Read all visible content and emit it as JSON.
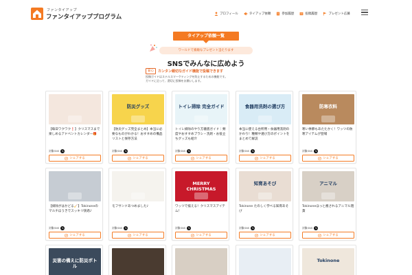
{
  "header": {
    "brand_sub": "ファンタイアップ",
    "brand_main": "ファンタイアッププログラム",
    "nav": [
      {
        "label": "プロフィール",
        "icon": "person-icon"
      },
      {
        "label": "タイアップ依頼",
        "icon": "megaphone-icon"
      },
      {
        "label": "参加履歴",
        "icon": "document-icon"
      },
      {
        "label": "投稿履歴",
        "icon": "list-icon"
      },
      {
        "label": "プレゼント応募",
        "icon": "flag-icon"
      }
    ]
  },
  "section": {
    "badge": "タイアップ依頼一覧",
    "promo": "ワールドで素敵なプレゼント当たります",
    "headline": "SNSでみんなに広めよう",
    "safe_badge": "安心",
    "safe_text": "カンタン親切なガイド機能で投稿できます",
    "desc_1": "投稿ガイドはステルスマーケティングを防止するための機能です。",
    "desc_2": "ガイドに沿って、適切に投稿をお願いします。"
  },
  "cards": [
    {
      "title": "【毎日ワクワク❗️】クリスマスまで楽しめるアドベントカレンダー🎁",
      "target": "対象SNS",
      "share": "シェアする",
      "thumb": "advent",
      "color": "#f4e7de"
    },
    {
      "title": "【防災グッズ完全まとめ】本当に必要なものがわかる！おすすめの備品リストと保存方法",
      "target": "対象SNS",
      "share": "シェアする",
      "thumb": "bousai",
      "color": "#f7d44c",
      "thumb_text": "防災グッズ"
    },
    {
      "title": "トイレ掃除のやり方徹底ガイド｜頻度やおすすめブラシ・洗剤・お役立ちグッズも紹介",
      "target": "対象SNS",
      "share": "シェアする",
      "thumb": "toilet",
      "color": "#e8f4f8",
      "thumb_text": "トイレ掃除 完全ガイド"
    },
    {
      "title": "本当に使える台所用・食器用洗剤のかわり！種類や選び方のポイントをまとめて解説",
      "target": "対象SNS",
      "share": "シェアする",
      "thumb": "dish",
      "color": "#d9ecf6",
      "thumb_text": "食器用洗剤の選び方"
    },
    {
      "title": "寒い季節もあたたかく！ワッツの防寒アイテムが登場",
      "target": "対象SNS",
      "share": "シェアする",
      "thumb": "winter",
      "color": "#b98a5e",
      "thumb_text": "防寒衣料"
    },
    {
      "title": "【掃除がはかどる🧹】Tokinoneのマルチほうきでスッキリ快適♪",
      "target": "対象SNS",
      "share": "シェアする",
      "thumb": "broom",
      "color": "#c6ccd3"
    },
    {
      "title": "モフサンドあつめました♪",
      "target": "対象SNS",
      "share": "シェアする",
      "thumb": "mofu",
      "color": "#f5f3ee"
    },
    {
      "title": "ワッツで揃える！クリスマスアイテム！",
      "target": "対象SNS",
      "share": "シェアする",
      "thumb": "xmas",
      "color": "#c7192a",
      "thumb_text": "MERRY CHRISTMAS"
    },
    {
      "title": "Tokinone たのしく学べる知育あそび",
      "target": "対象SNS",
      "share": "シェアする",
      "thumb": "chiiku",
      "color": "#e9ddd3",
      "thumb_text": "知育あそび"
    },
    {
      "title": "Tokinoneほっと癒されるアニマル雑貨",
      "target": "対象SNS",
      "share": "シェアする",
      "thumb": "animal",
      "color": "#d8d0c6",
      "thumb_text": "アニマル"
    },
    {
      "title": "",
      "target": "",
      "share": "",
      "thumb": "bousai2",
      "color": "#3b4a5c",
      "thumb_text": "災害の備えに防災ボトル"
    },
    {
      "title": "",
      "target": "",
      "share": "",
      "thumb": "bag",
      "color": "#4a3b30"
    },
    {
      "title": "",
      "target": "",
      "share": "",
      "thumb": "goods",
      "color": "#d8cfc4"
    },
    {
      "title": "",
      "target": "",
      "share": "",
      "thumb": "plush",
      "color": "#e8eef4"
    },
    {
      "title": "",
      "target": "",
      "share": "",
      "thumb": "tokinone",
      "color": "#efe7dc",
      "thumb_text": "Tokinone"
    }
  ],
  "colors": {
    "accent": "#f47a22",
    "promo_bg": "#fde9dc"
  }
}
